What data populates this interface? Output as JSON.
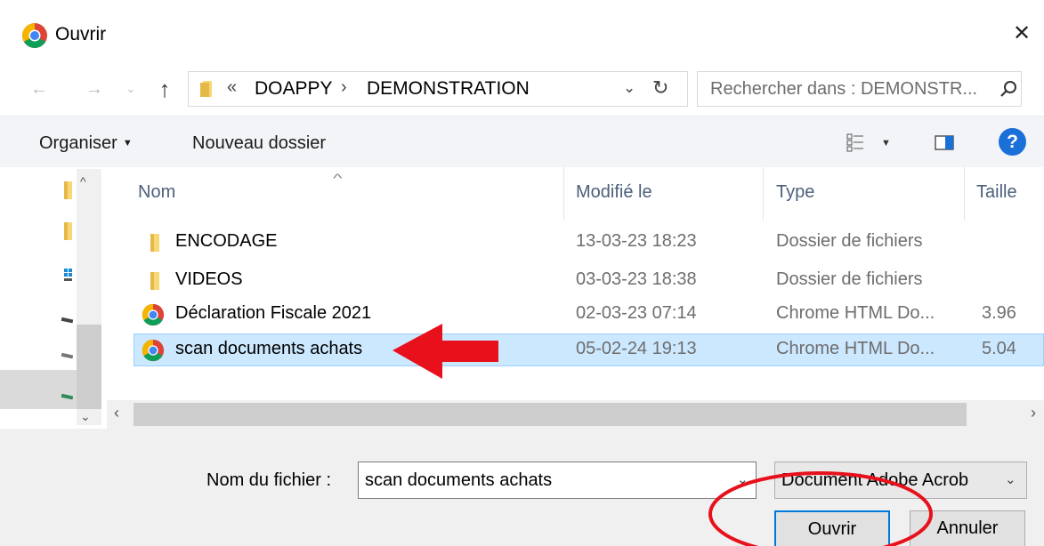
{
  "window": {
    "title": "Ouvrir",
    "close_glyph": "✕"
  },
  "navigation": {
    "back_glyph": "←",
    "forward_glyph": "→",
    "recent_glyph": "⌄",
    "up_glyph": "↑",
    "address": {
      "overflow": "«",
      "separator": "›",
      "crumbs": [
        "DOAPPY",
        "DEMONSTRATION"
      ],
      "dropdown_glyph": "⌄",
      "refresh_glyph": "↻"
    },
    "search": {
      "placeholder": "Rechercher dans : DEMONSTR..."
    }
  },
  "toolbar": {
    "organise_label": "Organiser",
    "organise_caret": "▼",
    "new_folder_label": "Nouveau dossier",
    "view_caret": "▼",
    "help_glyph": "?"
  },
  "file_list": {
    "columns": [
      "Nom",
      "Modifié le",
      "Type",
      "Taille"
    ],
    "sort_glyph": "^",
    "rows": [
      {
        "name": "ENCODAGE",
        "modified": "13-03-23 18:23",
        "type": "Dossier de fichiers",
        "size": "",
        "icon": "folder-icon"
      },
      {
        "name": "VIDEOS",
        "modified": "03-03-23 18:38",
        "type": "Dossier de fichiers",
        "size": "",
        "icon": "folder-icon"
      },
      {
        "name": "Déclaration Fiscale 2021",
        "modified": "02-03-23 07:14",
        "type": "Chrome HTML Do...",
        "size": "3.96",
        "icon": "chrome-icon"
      },
      {
        "name": "scan documents achats",
        "modified": "05-02-24 19:13",
        "type": "Chrome HTML Do...",
        "size": "5.04",
        "icon": "chrome-icon"
      }
    ],
    "selected_index": 3
  },
  "scrollbar_glyphs": {
    "up": "^",
    "down": "⌄",
    "left": "‹",
    "right": "›"
  },
  "footer": {
    "filename_label": "Nom du fichier :",
    "filename_value": "scan documents achats",
    "filename_caret": "⌄",
    "filetype_value": "Document Adobe Acrob",
    "filetype_caret": "⌄",
    "open_button": "Ouvrir",
    "cancel_button": "Annuler"
  },
  "colors": {
    "annotation": "#e8101a",
    "selection_bg": "#cce8ff",
    "selection_border": "#99d1ff",
    "default_button_border": "#0078d7",
    "toolbar_bg": "#f2f4f8",
    "help_blue": "#1a6fd9",
    "folder_yellow": "#f8d775"
  }
}
